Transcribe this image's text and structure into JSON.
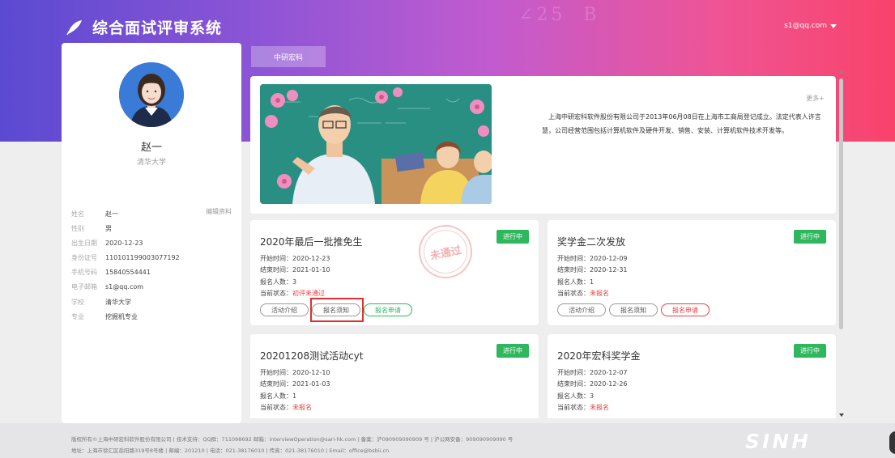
{
  "header": {
    "app_title": "综合面试评审系统",
    "user_email": "s1@qq.com",
    "brand_gradient": [
      "#5a4ad1",
      "#f8436a"
    ]
  },
  "tabs": [
    {
      "label": "中研宏科",
      "active": true
    }
  ],
  "profile": {
    "name": "赵一",
    "school": "清华大学",
    "edit_label": "编辑资料",
    "fields": [
      {
        "label": "姓名",
        "value": "赵一"
      },
      {
        "label": "性别",
        "value": "男"
      },
      {
        "label": "出生日期",
        "value": "2020-12-23"
      },
      {
        "label": "身份证号",
        "value": "110101199003077192"
      },
      {
        "label": "手机号码",
        "value": "15840554441"
      },
      {
        "label": "电子邮箱",
        "value": "s1@qq.com"
      },
      {
        "label": "学校",
        "value": "清华大学"
      },
      {
        "label": "专业",
        "value": "挖掘机专业"
      }
    ]
  },
  "intro": {
    "more_label": "更多+",
    "text": "上海中研宏科软件股份有限公司于2013年06月08日在上海市工商局登记成立。法定代表人许言慧，公司经营范围包括计算机软件及硬件开发、销售、安装、计算机软件技术开发等。"
  },
  "card_labels": {
    "start": "开始时间：",
    "end": "结束时间：",
    "count": "报名人数：",
    "status": "当前状态：",
    "btn_intro": "活动介绍",
    "btn_notice": "报名须知",
    "btn_apply": "报名申请"
  },
  "cards": [
    {
      "title": "2020年最后一批推免生",
      "badge": "进行中",
      "start": "2020-12-23",
      "end": "2021-01-10",
      "count": "3",
      "status": "初评未通过",
      "stamp": "未通过"
    },
    {
      "title": "奖学金二次发放",
      "badge": "进行中",
      "start": "2020-12-09",
      "end": "2020-12-31",
      "count": "1",
      "status": "未报名"
    },
    {
      "title": "20201208测试活动cyt",
      "badge": "进行中",
      "start": "2020-12-10",
      "end": "2021-01-03",
      "count": "1",
      "status": "未报名"
    },
    {
      "title": "2020年宏科奖学金",
      "badge": "进行中",
      "start": "2020-12-07",
      "end": "2020-12-26",
      "count": "3",
      "status": "未报名"
    }
  ],
  "footer": {
    "line1": "版权所有©上海中研宏科软件股份有限公司 | 技术支持：QQ群：711098692 邮箱：interviewOperation@sari-hk.com | 备案：沪090909090909 号 | 沪公网安备：909090909090 号",
    "line2": "地址：上海市徐汇区岳阳路319号8号楼 | 邮编：201210 | 电话：021-38176010 | 传真：021-38176010 | Email：office@bsbii.cn",
    "logo_text": "SINH"
  }
}
